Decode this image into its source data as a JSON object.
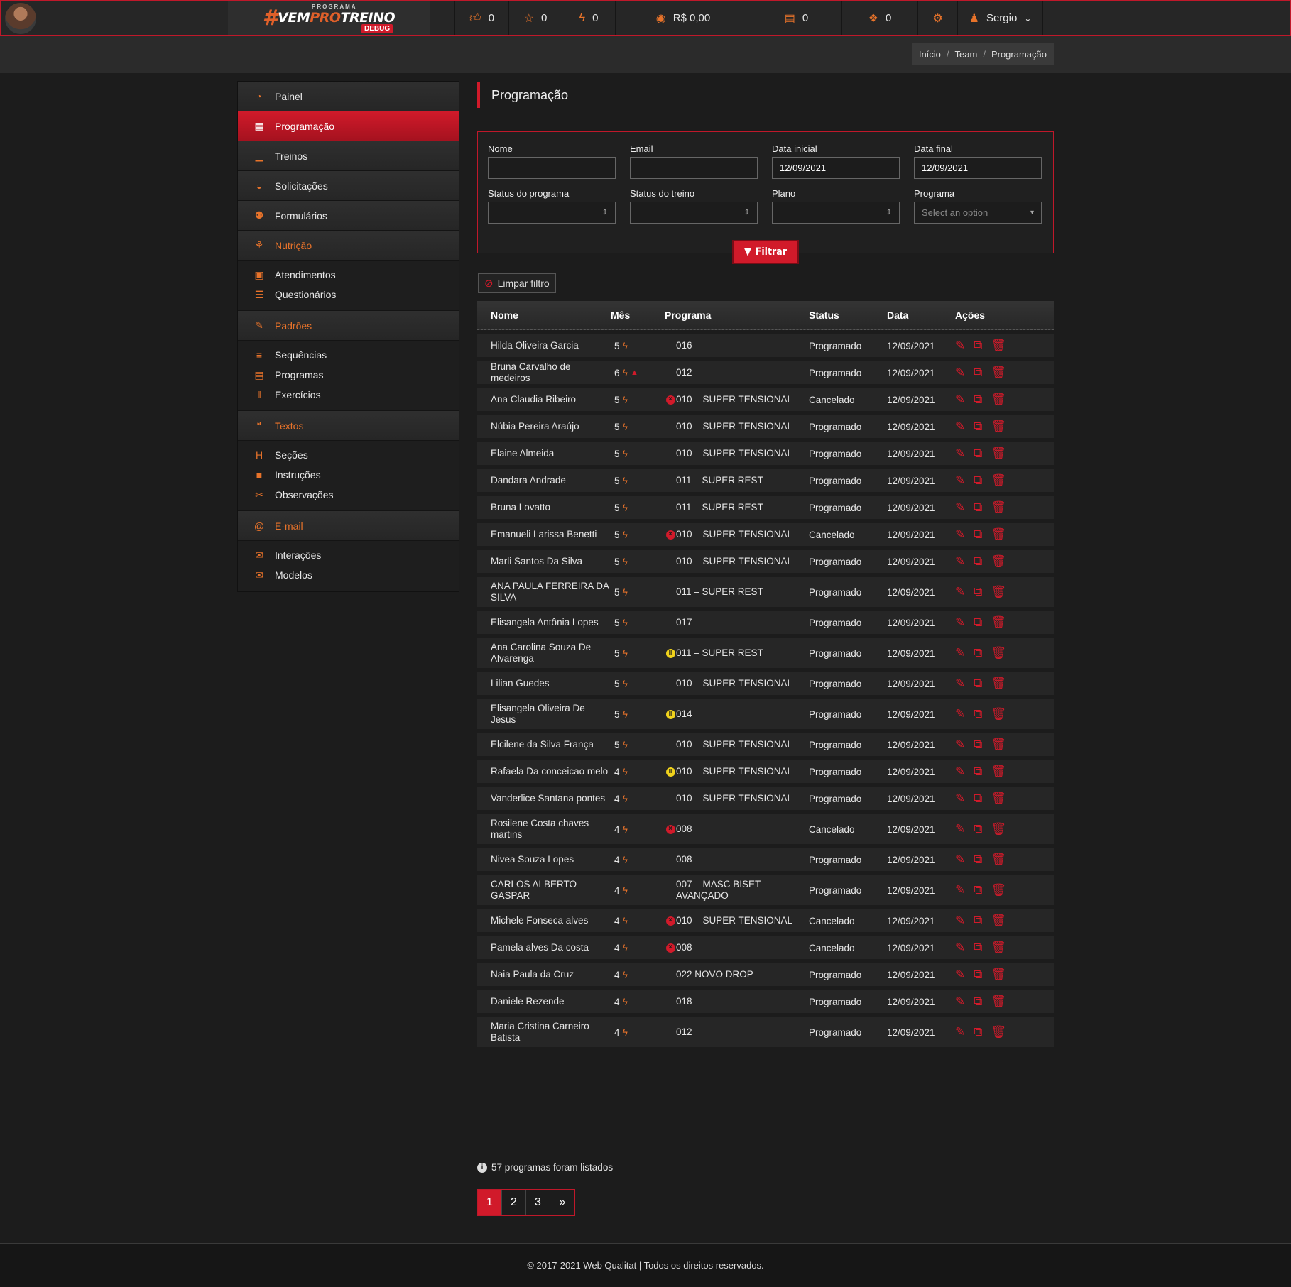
{
  "topbar": {
    "logo": {
      "prefix": "#",
      "word1": "VEM",
      "word2": "PRO",
      "word3": "TREINO",
      "super": "PROGRAMA",
      "badge": "DEBUG"
    },
    "counters": [
      {
        "icon": "thumbs-up-icon",
        "glyph": "👍︎",
        "value": "0"
      },
      {
        "icon": "star-icon",
        "glyph": "☆",
        "value": "0"
      },
      {
        "icon": "bolt-icon",
        "glyph": "ϟ",
        "value": "0"
      },
      {
        "icon": "money-icon",
        "glyph": "◉",
        "value": "R$ 0,00"
      },
      {
        "icon": "file-icon",
        "glyph": "▤",
        "value": "0"
      },
      {
        "icon": "paw-icon",
        "glyph": "❖",
        "value": "0"
      }
    ],
    "settings_glyph": "⚙",
    "user": {
      "name": "Sergio",
      "glyph": "▲"
    }
  },
  "breadcrumb": [
    "Início",
    "Team",
    "Programação"
  ],
  "sidebar": {
    "top": [
      {
        "label": "Painel",
        "glyph": "◔",
        "active": false
      },
      {
        "label": "Programação",
        "glyph": "▦",
        "active": true
      },
      {
        "label": "Treinos",
        "glyph": "▁",
        "active": false
      },
      {
        "label": "Solicitações",
        "glyph": "◒",
        "active": false
      },
      {
        "label": "Formulários",
        "glyph": "⚉",
        "active": false
      }
    ],
    "groups": [
      {
        "label": "Nutrição",
        "glyph": "⚘",
        "items": [
          {
            "label": "Atendimentos",
            "glyph": "▣"
          },
          {
            "label": "Questionários",
            "glyph": "☰"
          }
        ]
      },
      {
        "label": "Padrões",
        "glyph": "✎",
        "items": [
          {
            "label": "Sequências",
            "glyph": "≡"
          },
          {
            "label": "Programas",
            "glyph": "▤"
          },
          {
            "label": "Exercícios",
            "glyph": "‖"
          }
        ]
      },
      {
        "label": "Textos",
        "glyph": "❝",
        "items": [
          {
            "label": "Seções",
            "glyph": "H"
          },
          {
            "label": "Instruções",
            "glyph": "■"
          },
          {
            "label": "Observações",
            "glyph": "✂"
          }
        ]
      },
      {
        "label": "E-mail",
        "glyph": "@",
        "items": [
          {
            "label": "Interações",
            "glyph": "✉"
          },
          {
            "label": "Modelos",
            "glyph": "✉"
          }
        ]
      }
    ]
  },
  "page_title": "Programação",
  "filter": {
    "nome": {
      "label": "Nome",
      "value": ""
    },
    "email": {
      "label": "Email",
      "value": ""
    },
    "data_inicial": {
      "label": "Data inicial",
      "value": "12/09/2021"
    },
    "data_final": {
      "label": "Data final",
      "value": "12/09/2021"
    },
    "status_programa": {
      "label": "Status do programa",
      "value": ""
    },
    "status_treino": {
      "label": "Status do treino",
      "value": ""
    },
    "plano": {
      "label": "Plano",
      "value": ""
    },
    "programa": {
      "label": "Programa",
      "placeholder": "Select an option"
    },
    "submit_label": "Filtrar",
    "clear_label": "Limpar filtro"
  },
  "table": {
    "headers": {
      "nome": "Nome",
      "mes": "Mês",
      "programa": "Programa",
      "status": "Status",
      "data": "Data",
      "acoes": "Ações"
    },
    "rows": [
      {
        "nome": "Hilda Oliveira Garcia",
        "mes": "5",
        "warn": false,
        "flag": "",
        "programa": "016",
        "status": "Programado",
        "data": "12/09/2021"
      },
      {
        "nome": "Bruna Carvalho de medeiros",
        "mes": "6",
        "warn": true,
        "flag": "",
        "programa": "012",
        "status": "Programado",
        "data": "12/09/2021"
      },
      {
        "nome": "Ana Claudia Ribeiro",
        "mes": "5",
        "warn": false,
        "flag": "cancel",
        "programa": "010 – SUPER TENSIONAL",
        "status": "Cancelado",
        "data": "12/09/2021"
      },
      {
        "nome": "Núbia Pereira Araújo",
        "mes": "5",
        "warn": false,
        "flag": "",
        "programa": "010 – SUPER TENSIONAL",
        "status": "Programado",
        "data": "12/09/2021"
      },
      {
        "nome": "Elaine Almeida",
        "mes": "5",
        "warn": false,
        "flag": "",
        "programa": "010 – SUPER TENSIONAL",
        "status": "Programado",
        "data": "12/09/2021"
      },
      {
        "nome": "Dandara Andrade",
        "mes": "5",
        "warn": false,
        "flag": "",
        "programa": "011 – SUPER REST",
        "status": "Programado",
        "data": "12/09/2021"
      },
      {
        "nome": "Bruna Lovatto",
        "mes": "5",
        "warn": false,
        "flag": "",
        "programa": "011 – SUPER REST",
        "status": "Programado",
        "data": "12/09/2021"
      },
      {
        "nome": "Emanueli Larissa Benetti",
        "mes": "5",
        "warn": false,
        "flag": "cancel",
        "programa": "010 – SUPER TENSIONAL",
        "status": "Cancelado",
        "data": "12/09/2021"
      },
      {
        "nome": "Marli Santos Da Silva",
        "mes": "5",
        "warn": false,
        "flag": "",
        "programa": "010 – SUPER TENSIONAL",
        "status": "Programado",
        "data": "12/09/2021"
      },
      {
        "nome": "ANA PAULA FERREIRA DA SILVA",
        "mes": "5",
        "warn": false,
        "flag": "",
        "programa": "011 – SUPER REST",
        "status": "Programado",
        "data": "12/09/2021"
      },
      {
        "nome": "Elisangela Antônia Lopes",
        "mes": "5",
        "warn": false,
        "flag": "",
        "programa": "017",
        "status": "Programado",
        "data": "12/09/2021"
      },
      {
        "nome": "Ana Carolina Souza De Alvarenga",
        "mes": "5",
        "warn": false,
        "flag": "pause",
        "programa": "011 – SUPER REST",
        "status": "Programado",
        "data": "12/09/2021"
      },
      {
        "nome": "Lilian Guedes",
        "mes": "5",
        "warn": false,
        "flag": "",
        "programa": "010 – SUPER TENSIONAL",
        "status": "Programado",
        "data": "12/09/2021"
      },
      {
        "nome": "Elisangela Oliveira De Jesus",
        "mes": "5",
        "warn": false,
        "flag": "pause",
        "programa": "014",
        "status": "Programado",
        "data": "12/09/2021"
      },
      {
        "nome": "Elcilene da Silva França",
        "mes": "5",
        "warn": false,
        "flag": "",
        "programa": "010 – SUPER TENSIONAL",
        "status": "Programado",
        "data": "12/09/2021"
      },
      {
        "nome": "Rafaela Da conceicao melo",
        "mes": "4",
        "warn": false,
        "flag": "pause",
        "programa": "010 – SUPER TENSIONAL",
        "status": "Programado",
        "data": "12/09/2021"
      },
      {
        "nome": "Vanderlice Santana pontes",
        "mes": "4",
        "warn": false,
        "flag": "",
        "programa": "010 – SUPER TENSIONAL",
        "status": "Programado",
        "data": "12/09/2021"
      },
      {
        "nome": "Rosilene Costa chaves martins",
        "mes": "4",
        "warn": false,
        "flag": "cancel",
        "programa": "008",
        "status": "Cancelado",
        "data": "12/09/2021"
      },
      {
        "nome": "Nivea Souza Lopes",
        "mes": "4",
        "warn": false,
        "flag": "",
        "programa": "008",
        "status": "Programado",
        "data": "12/09/2021"
      },
      {
        "nome": "CARLOS ALBERTO GASPAR",
        "mes": "4",
        "warn": false,
        "flag": "",
        "programa": "007 – MASC BISET AVANÇADO",
        "status": "Programado",
        "data": "12/09/2021"
      },
      {
        "nome": "Michele Fonseca alves",
        "mes": "4",
        "warn": false,
        "flag": "cancel",
        "programa": "010 – SUPER TENSIONAL",
        "status": "Cancelado",
        "data": "12/09/2021"
      },
      {
        "nome": "Pamela alves Da costa",
        "mes": "4",
        "warn": false,
        "flag": "cancel",
        "programa": "008",
        "status": "Cancelado",
        "data": "12/09/2021"
      },
      {
        "nome": "Naia Paula da Cruz",
        "mes": "4",
        "warn": false,
        "flag": "",
        "programa": "022 NOVO DROP",
        "status": "Programado",
        "data": "12/09/2021"
      },
      {
        "nome": "Daniele Rezende",
        "mes": "4",
        "warn": false,
        "flag": "",
        "programa": "018",
        "status": "Programado",
        "data": "12/09/2021"
      },
      {
        "nome": "Maria Cristina Carneiro Batista",
        "mes": "4",
        "warn": false,
        "flag": "",
        "programa": "012",
        "status": "Programado",
        "data": "12/09/2021"
      }
    ],
    "action_glyphs": {
      "edit": "✎",
      "copy": "⧉",
      "delete": "✖"
    }
  },
  "listed_text": "57 programas foram listados",
  "pagination": [
    "1",
    "2",
    "3",
    "»"
  ],
  "footer": "© 2017-2021 Web Qualitat | Todos os direitos reservados.",
  "colors": {
    "accent": "#d11a2a",
    "orange": "#e8732a",
    "pause": "#f0d21c"
  }
}
